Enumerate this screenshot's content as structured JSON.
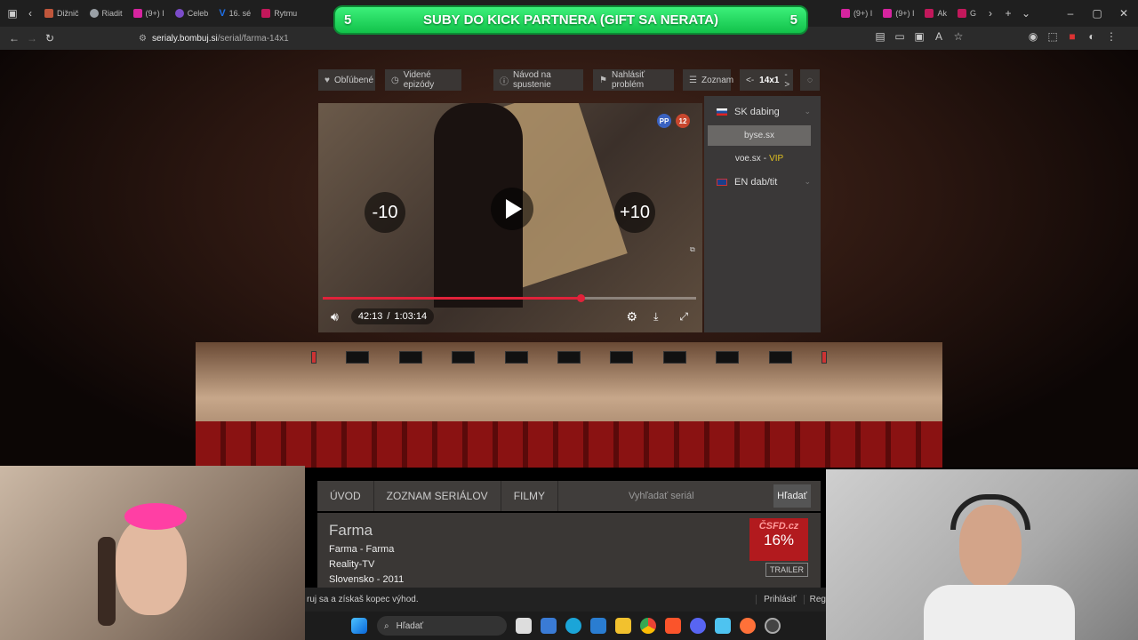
{
  "browser": {
    "tabs": [
      {
        "label": "Dižnič",
        "color": "#c0563b"
      },
      {
        "label": "Riadit",
        "color": "#9aa0a6"
      },
      {
        "label": "(9+) I",
        "color": "#d6249f"
      },
      {
        "label": "Celeb",
        "color": "#7b4cc9"
      },
      {
        "label": "16. sé",
        "color": "#1d6fe8"
      },
      {
        "label": "Rytmu",
        "color": "#c2185b"
      },
      {
        "label": "(9+) I",
        "color": "#d6249f"
      },
      {
        "label": "(9+) I",
        "color": "#d6249f"
      },
      {
        "label": "Ak",
        "color": "#c2185b"
      },
      {
        "label": "G",
        "color": "#c2185b"
      }
    ],
    "url_domain": "serialy.bombuj.si",
    "url_path": "/serial/farma-14x1"
  },
  "banner": {
    "left_num": "5",
    "text": "SUBY DO KICK PARTNERA (GIFT SA NERATA)",
    "right_num": "5"
  },
  "toolbar": {
    "favorites": "Obľúbené",
    "watched": "Videné epizódy",
    "guide": "Návod na spustenie",
    "report": "Nahlásiť problém",
    "list": "Zoznam",
    "prev": "<-",
    "episode": "14x1",
    "next": "->"
  },
  "player": {
    "skip_back": "-10",
    "skip_fwd": "+10",
    "current_time": "42:13",
    "separator": "/",
    "duration": "1:03:14",
    "progress_fraction": 0.69,
    "badge_pp": "PP",
    "badge_age": "12"
  },
  "sources": {
    "sk_label": "SK dabing",
    "host1": "byse.sx",
    "host2": "voe.sx",
    "host2_sep": "-",
    "host2_tag": "VIP",
    "en_label": "EN dab/tit"
  },
  "site_nav": {
    "uvod": "ÚVOD",
    "serials": "ZOZNAM SERIÁLOV",
    "films": "FILMY",
    "search_placeholder": "Vyhľadať seriál",
    "search_button": "Hľadať"
  },
  "show": {
    "title": "Farma",
    "subtitle": "Farma - Farma",
    "genre": "Reality-TV",
    "origin": "Slovensko - 2011",
    "score_brand": "ČSFD.cz",
    "score": "16%",
    "trailer": "TRAILER"
  },
  "footer": {
    "promo": "ruj sa a získaš kopec výhod.",
    "login": "Prihlásiť",
    "register": "Reg"
  },
  "taskbar": {
    "search": "Hľadať"
  },
  "colors": {
    "accent_red": "#e0223a",
    "vip_yellow": "#e0c020",
    "banner_green": "#1fd55c"
  }
}
